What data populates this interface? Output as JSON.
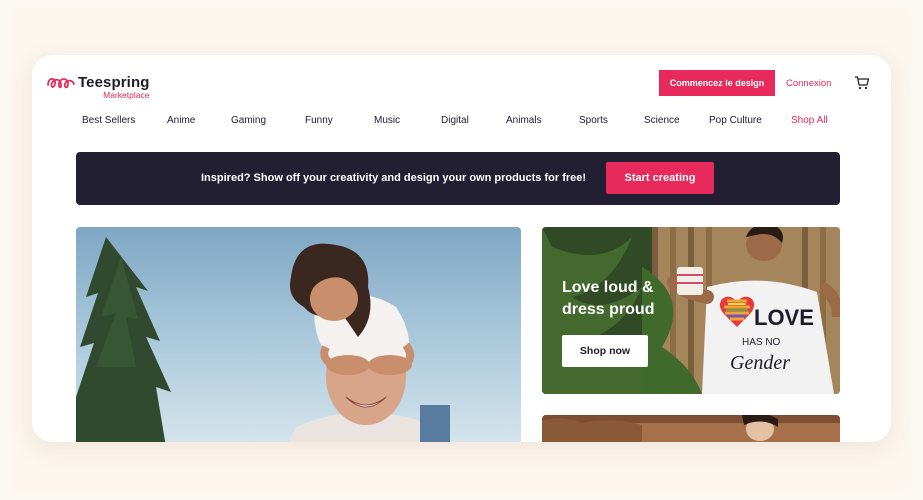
{
  "brand": {
    "name": "Teespring",
    "subtitle": "Marketplace",
    "accent": "#e8295b",
    "dark": "#221f33"
  },
  "header": {
    "cta_label": "Commencez le design",
    "login_label": "Connexion",
    "cart_icon": "cart-icon"
  },
  "nav": {
    "items": [
      {
        "label": "Best Sellers"
      },
      {
        "label": "Anime"
      },
      {
        "label": "Gaming"
      },
      {
        "label": "Funny"
      },
      {
        "label": "Music"
      },
      {
        "label": "Digital"
      },
      {
        "label": "Animals"
      },
      {
        "label": "Sports"
      },
      {
        "label": "Science"
      },
      {
        "label": "Pop Culture"
      },
      {
        "label": "Shop All"
      }
    ]
  },
  "banner": {
    "text": "Inspired? Show off your creativity and design your own products for free!",
    "button_label": "Start creating"
  },
  "promo_side": {
    "headline": "Love loud & dress proud",
    "button_label": "Shop now",
    "shirt_print_line1": "LOVE",
    "shirt_print_line2": "HAS NO",
    "shirt_print_line3": "Gender"
  }
}
